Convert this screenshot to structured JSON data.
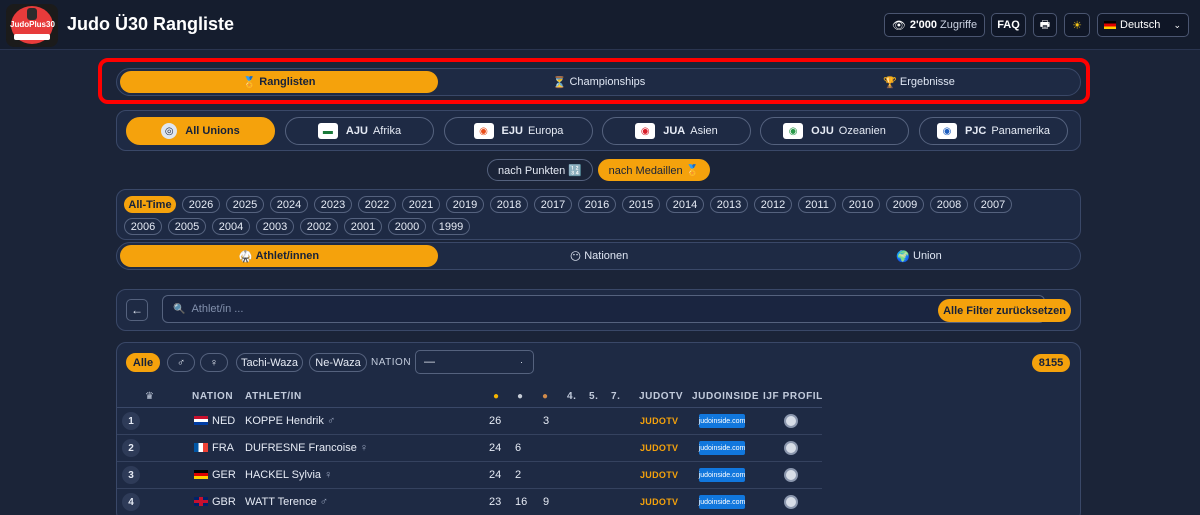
{
  "app": {
    "title": "Judo Ü30 Rangliste",
    "logo_text": "JudoPlus30"
  },
  "topbar": {
    "views_value": "2'000",
    "views_label": "Zugriffe",
    "faq_label": "FAQ",
    "language": "Deutsch"
  },
  "main_tabs": [
    {
      "icon": "🏅",
      "label": "Ranglisten",
      "active": true
    },
    {
      "icon": "⏳",
      "label": "Championships",
      "active": false
    },
    {
      "icon": "🏆",
      "label": "Ergebnisse",
      "active": false
    }
  ],
  "unions": [
    {
      "code": "",
      "name": "All Unions",
      "active": true
    },
    {
      "code": "AJU",
      "name": "Afrika",
      "active": false
    },
    {
      "code": "EJU",
      "name": "Europa",
      "active": false
    },
    {
      "code": "JUA",
      "name": "Asien",
      "active": false
    },
    {
      "code": "OJU",
      "name": "Ozeanien",
      "active": false
    },
    {
      "code": "PJC",
      "name": "Panamerika",
      "active": false
    }
  ],
  "sort_options": [
    {
      "label": "nach Punkten 🔢",
      "active": false
    },
    {
      "label": "nach Medaillen 🏅",
      "active": true
    }
  ],
  "years": [
    "All-Time",
    "2026",
    "2025",
    "2024",
    "2023",
    "2022",
    "2021",
    "2019",
    "2018",
    "2017",
    "2016",
    "2015",
    "2014",
    "2013",
    "2012",
    "2011",
    "2010",
    "2009",
    "2008",
    "2007",
    "2006",
    "2005",
    "2004",
    "2003",
    "2002",
    "2001",
    "2000",
    "1999"
  ],
  "active_year": "All-Time",
  "view_tabs": [
    {
      "icon": "🥋",
      "label": "Athlet/innen",
      "active": true
    },
    {
      "icon": "😶",
      "label": "Nationen",
      "active": false
    },
    {
      "icon": "🌍",
      "label": "Union",
      "active": false
    }
  ],
  "search": {
    "placeholder": "Athlet/in ...",
    "reset_label": "Alle Filter zurücksetzen"
  },
  "filters": {
    "all_label": "Alle",
    "male_symbol": "♂",
    "female_symbol": "♀",
    "tachi_label": "Tachi-Waza",
    "ne_label": "Ne-Waza",
    "nation_label": "NATION",
    "nation_value": "—",
    "result_count": "8155"
  },
  "table": {
    "headers": {
      "nation": "NATION",
      "athlete": "ATHLET/IN",
      "p4": "4.",
      "p5": "5.",
      "p7": "7.",
      "judotv": "JUDOTV",
      "judoinside": "JUDOINSIDE",
      "ijf": "IJF PROFIL"
    },
    "rows": [
      {
        "rank": "1",
        "nation": "NED",
        "athlete": "KOPPE Hendrik",
        "gender": "♂",
        "gold": "26",
        "silver": "",
        "bronze": "3",
        "judotv": "JUDOTV",
        "judoinside": "judoinside.com"
      },
      {
        "rank": "2",
        "nation": "FRA",
        "athlete": "DUFRESNE Francoise",
        "gender": "♀",
        "gold": "24",
        "silver": "6",
        "bronze": "",
        "judotv": "JUDOTV",
        "judoinside": "judoinside.com"
      },
      {
        "rank": "3",
        "nation": "GER",
        "athlete": "HACKEL Sylvia",
        "gender": "♀",
        "gold": "24",
        "silver": "2",
        "bronze": "",
        "judotv": "JUDOTV",
        "judoinside": "judoinside.com"
      },
      {
        "rank": "4",
        "nation": "GBR",
        "athlete": "WATT Terence",
        "gender": "♂",
        "gold": "23",
        "silver": "16",
        "bronze": "9",
        "judotv": "JUDOTV",
        "judoinside": "judoinside.com"
      }
    ]
  }
}
